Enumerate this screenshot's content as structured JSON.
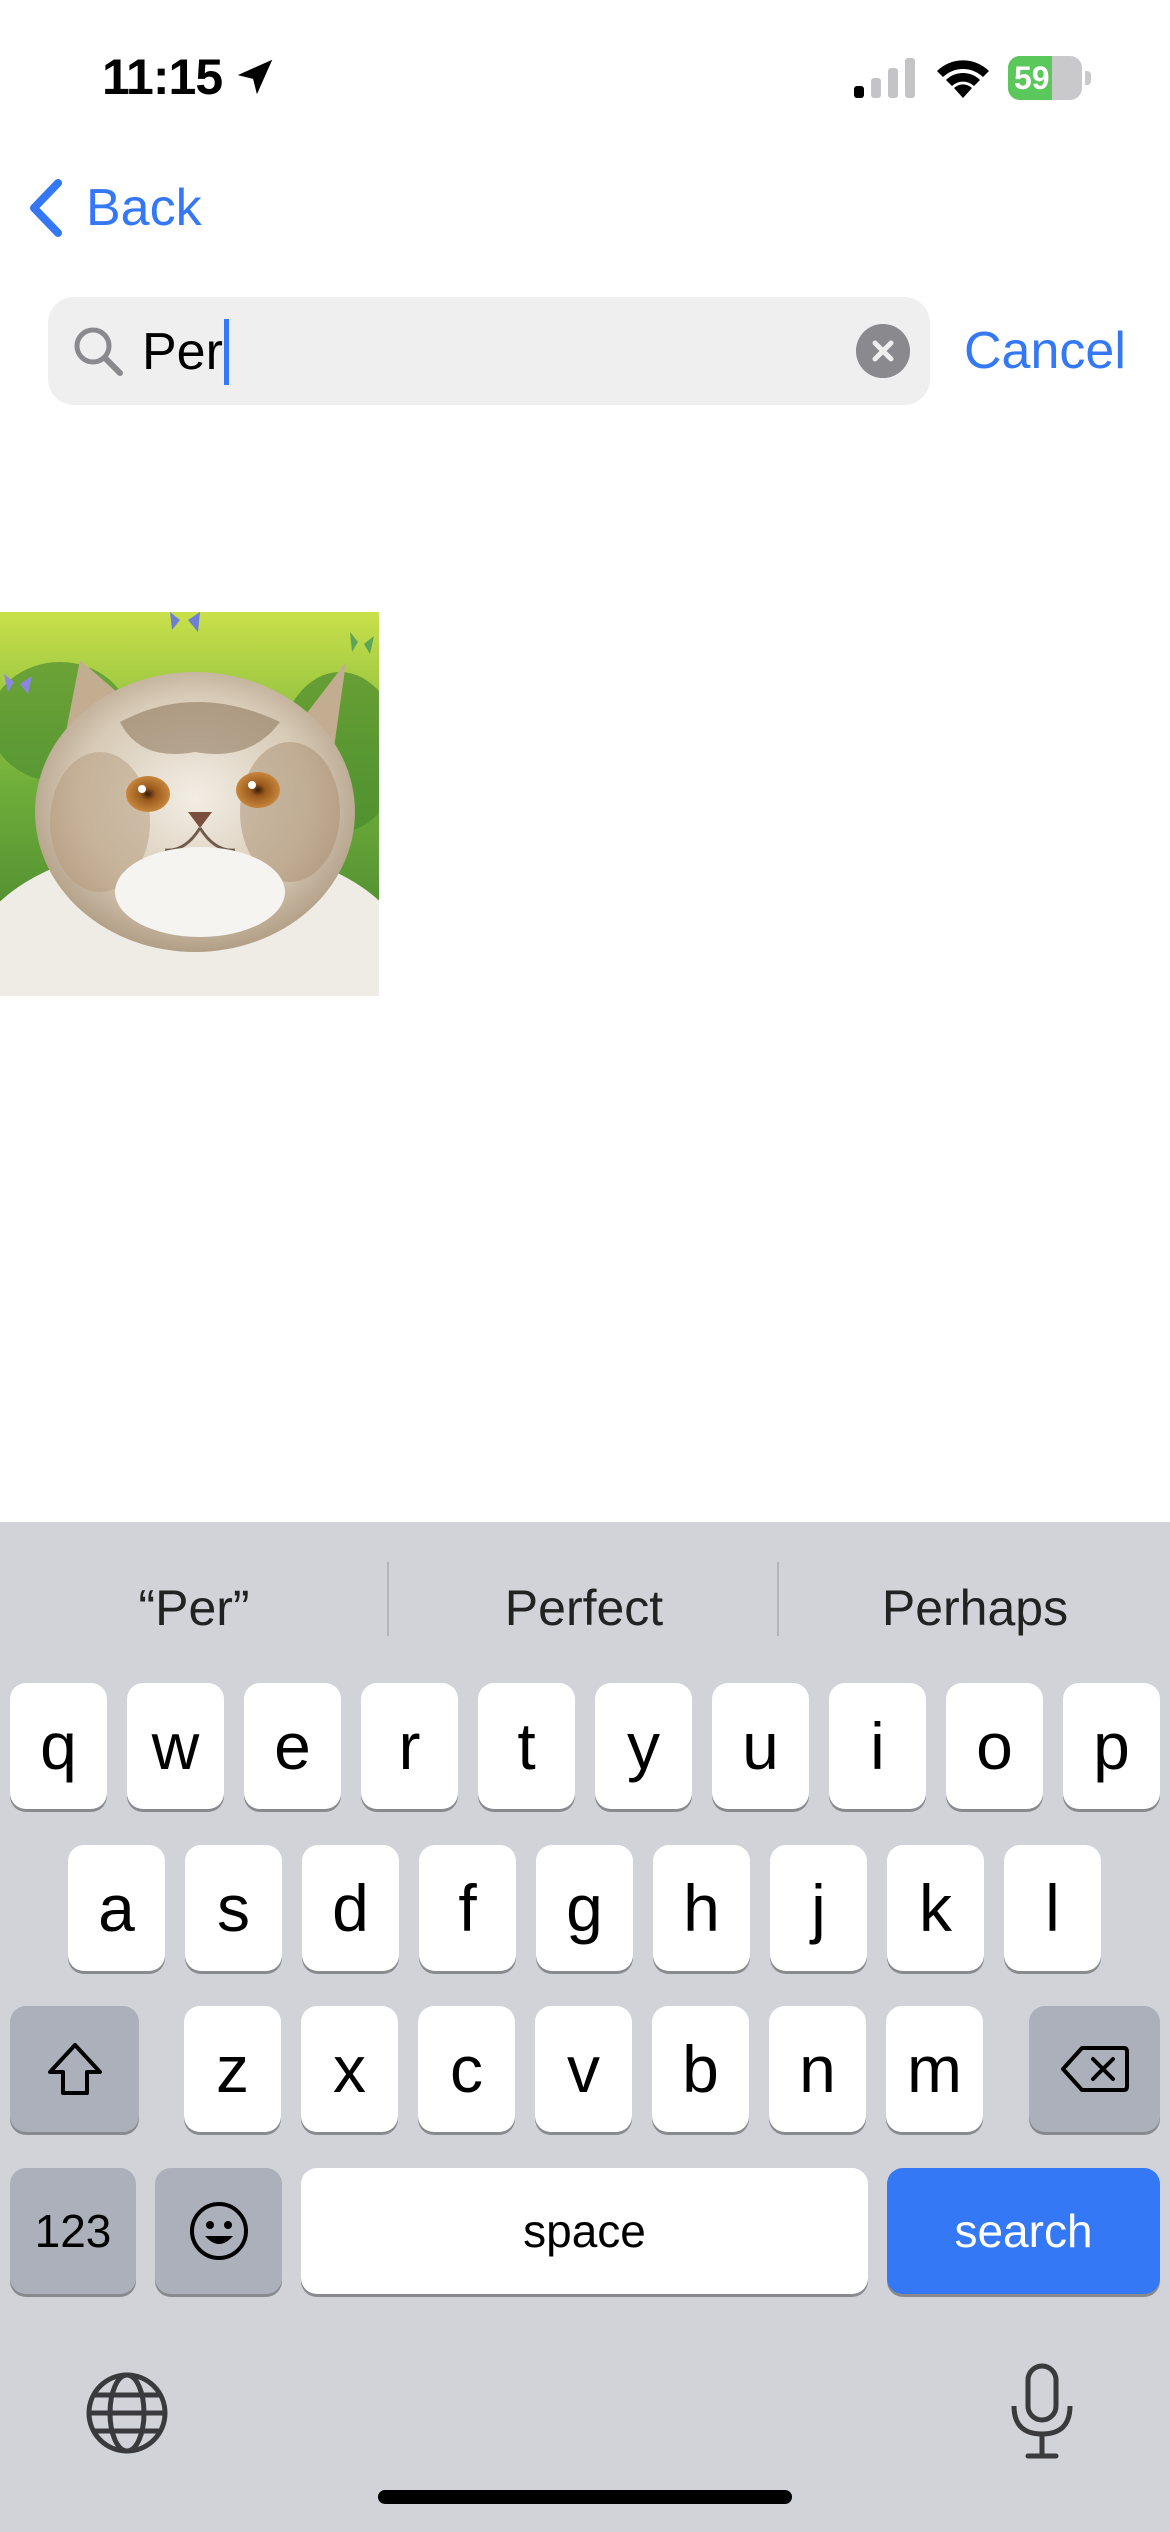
{
  "status_bar": {
    "time": "11:15",
    "battery_percent": "59",
    "battery_level": 0.59
  },
  "nav": {
    "back_label": "Back"
  },
  "search": {
    "query": "Per",
    "cancel_label": "Cancel"
  },
  "results": [
    {
      "kind": "image",
      "subject": "Persian cat"
    }
  ],
  "keyboard": {
    "suggestions": [
      "“Per”",
      "Perfect",
      "Perhaps"
    ],
    "row1": [
      "q",
      "w",
      "e",
      "r",
      "t",
      "y",
      "u",
      "i",
      "o",
      "p"
    ],
    "row2": [
      "a",
      "s",
      "d",
      "f",
      "g",
      "h",
      "j",
      "k",
      "l"
    ],
    "row3": [
      "z",
      "x",
      "c",
      "v",
      "b",
      "n",
      "m"
    ],
    "numbers_label": "123",
    "space_label": "space",
    "search_label": "search"
  },
  "colors": {
    "accent": "#3478f6",
    "keyboard_bg": "#d1d3d9",
    "battery": "#5ac85a"
  }
}
